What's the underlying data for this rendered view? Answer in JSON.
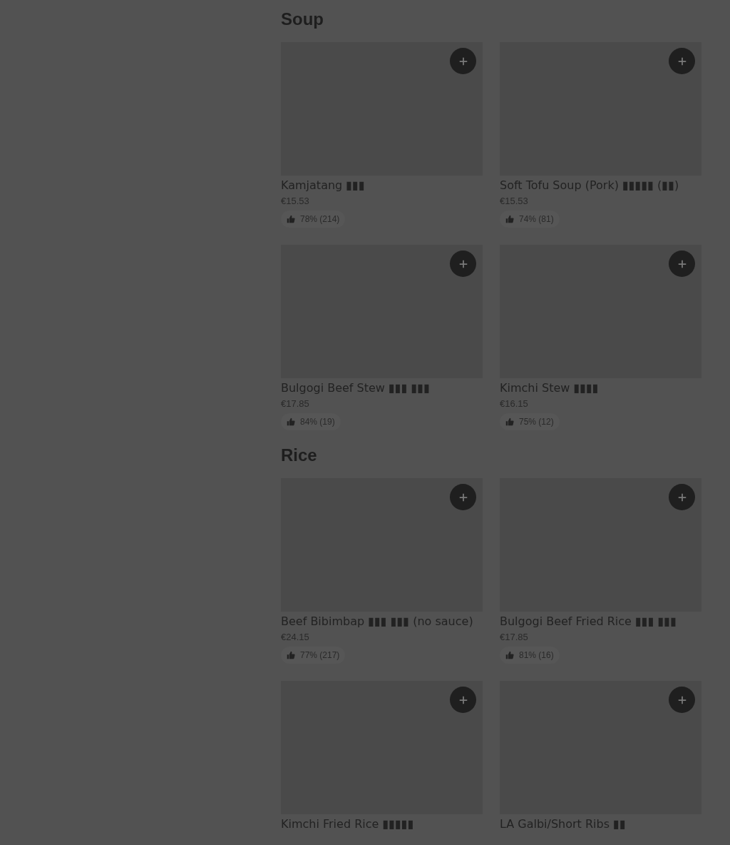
{
  "sections": [
    {
      "title": "Soup",
      "items": [
        {
          "name": "Kamjatang ▮▮▮",
          "price": "€15.53",
          "rating": "78% (214)"
        },
        {
          "name": "Soft Tofu Soup (Pork) ▮▮▮▮▮ (▮▮)",
          "price": "€15.53",
          "rating": "74% (81)"
        },
        {
          "name": "Bulgogi Beef Stew ▮▮▮ ▮▮▮",
          "price": "€17.85",
          "rating": "84% (19)"
        },
        {
          "name": "Kimchi Stew ▮▮▮▮",
          "price": "€16.15",
          "rating": "75% (12)"
        }
      ]
    },
    {
      "title": "Rice",
      "items": [
        {
          "name": "Beef Bibimbap ▮▮▮ ▮▮▮ (no sauce)",
          "price": "€24.15",
          "rating": "77% (217)"
        },
        {
          "name": "Bulgogi Beef Fried Rice ▮▮▮ ▮▮▮",
          "price": "€17.85",
          "rating": "81% (16)"
        },
        {
          "name": "Kimchi Fried Rice ▮▮▮▮▮"
        },
        {
          "name": "LA Galbi/Short Ribs ▮▮"
        }
      ]
    }
  ]
}
